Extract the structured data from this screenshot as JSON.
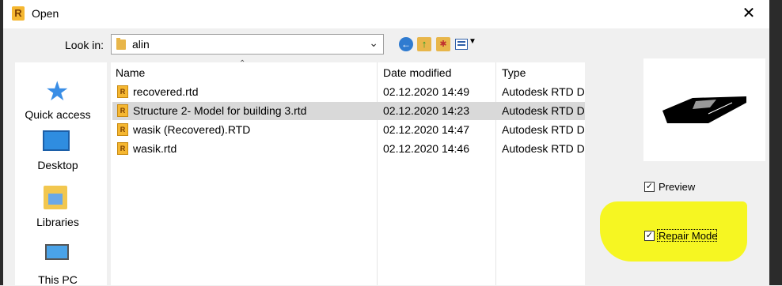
{
  "window": {
    "title": "Open",
    "app_icon_letter": "R",
    "close_glyph": "✕"
  },
  "lookin": {
    "label": "Look in:",
    "value": "alin"
  },
  "places": [
    {
      "label": "Quick access",
      "icon": "star-icon"
    },
    {
      "label": "Desktop",
      "icon": "desktop-icon"
    },
    {
      "label": "Libraries",
      "icon": "libraries-icon"
    },
    {
      "label": "This PC",
      "icon": "computer-icon"
    }
  ],
  "columns": {
    "name": "Name",
    "date": "Date modified",
    "type": "Type"
  },
  "files": [
    {
      "name": "recovered.rtd",
      "date": "02.12.2020 14:49",
      "type": "Autodesk RTD D",
      "selected": false
    },
    {
      "name": "Structure 2- Model for building 3.rtd",
      "date": "02.12.2020 14:23",
      "type": "Autodesk RTD D",
      "selected": true
    },
    {
      "name": "wasik (Recovered).RTD",
      "date": "02.12.2020 14:47",
      "type": "Autodesk RTD D",
      "selected": false
    },
    {
      "name": "wasik.rtd",
      "date": "02.12.2020 14:46",
      "type": "Autodesk RTD D",
      "selected": false
    }
  ],
  "options": {
    "preview_label": "Preview",
    "preview_checked": true,
    "repair_label": "Repair Mode",
    "repair_checked": true,
    "check_glyph": "✓"
  },
  "colors": {
    "highlight": "#f6f516",
    "selection": "#d9d9d9",
    "rtd_icon": "#f5b731"
  }
}
